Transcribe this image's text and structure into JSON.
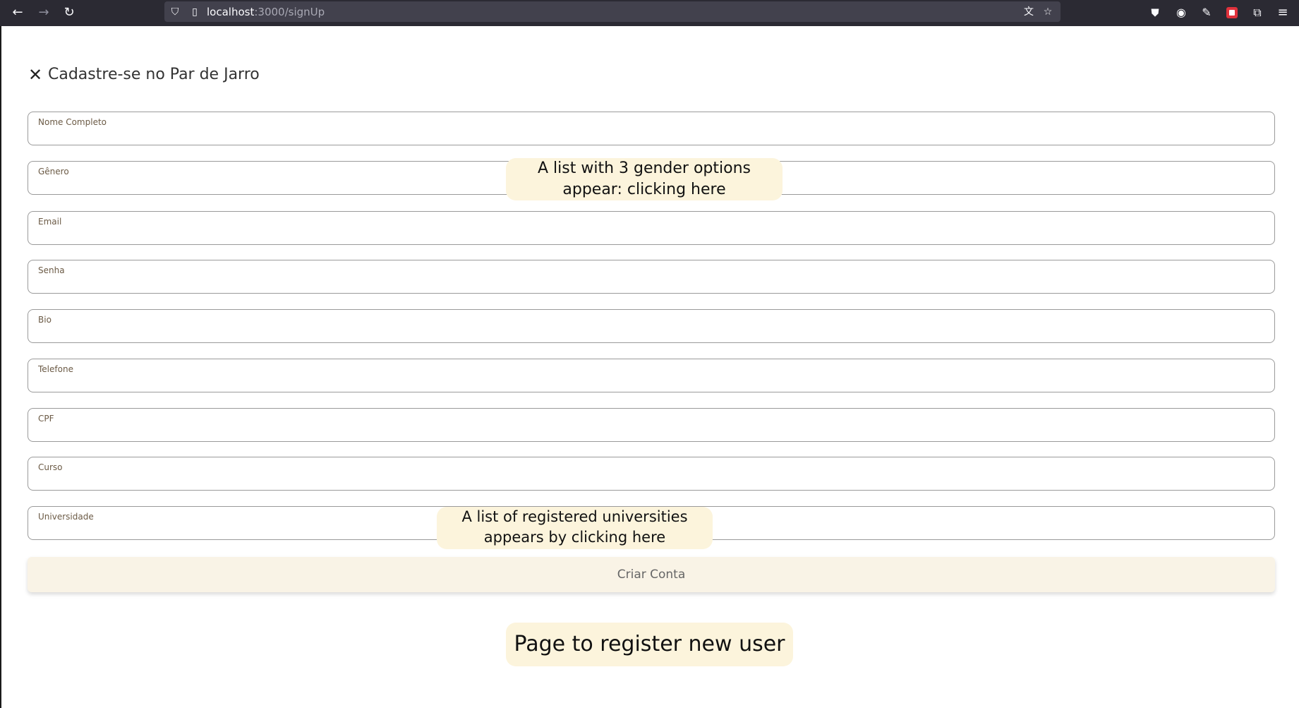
{
  "browser": {
    "url_host": "localhost",
    "url_path": ":3000/signUp",
    "icons": [
      "back-icon",
      "forward-icon",
      "reload-icon",
      "shield-icon",
      "page-icon",
      "translate-icon",
      "star-icon",
      "pocket-icon",
      "account-icon",
      "extension-icon",
      "extension-red-icon",
      "extensions-icon",
      "menu-icon"
    ]
  },
  "header": {
    "close_glyph": "✕",
    "title": "Cadastre-se no Par de Jarro"
  },
  "form": {
    "fields": [
      {
        "label": "Nome Completo"
      },
      {
        "label": "Gênero"
      },
      {
        "label": "Email"
      },
      {
        "label": "Senha"
      },
      {
        "label": "Bio"
      },
      {
        "label": "Telefone"
      },
      {
        "label": "CPF"
      },
      {
        "label": "Curso"
      },
      {
        "label": "Universidade"
      }
    ],
    "submit_label": "Criar Conta"
  },
  "annotations": {
    "gender_note_line1": "A list with 3 gender options",
    "gender_note_line2": "appear: clicking here",
    "university_note_line1": "A list of registered universities",
    "university_note_line2": "appears by clicking here",
    "page_note": "Page to register new user"
  },
  "colors": {
    "toolbar_bg": "#2b2a33",
    "button_bg": "#f9f3e6",
    "note_bg": "#fcf4dc"
  }
}
